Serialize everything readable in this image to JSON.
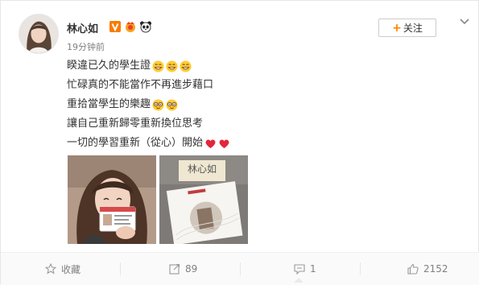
{
  "post": {
    "author": "林心如",
    "timestamp": "19分钟前",
    "follow_label": "关注",
    "lines": [
      "睽違已久的學生證",
      "忙碌真的不能當作不再進步藉口",
      "重拾當學生的樂趣",
      "讓自己重新歸零重新換位思考",
      "一切的學習重新（從心）開始"
    ],
    "badge_icons": [
      "verified-v-icon",
      "vip-icon",
      "panda-icon"
    ],
    "photo_2_text": "林心如"
  },
  "actions": {
    "favorite_label": "收藏",
    "repost_count": "89",
    "comment_count": "1",
    "like_count": "2152"
  },
  "colors": {
    "accent": "#ff8200",
    "verified": "#f77c00",
    "heart": "#e0283a",
    "text": "#333333",
    "muted": "#808080"
  }
}
